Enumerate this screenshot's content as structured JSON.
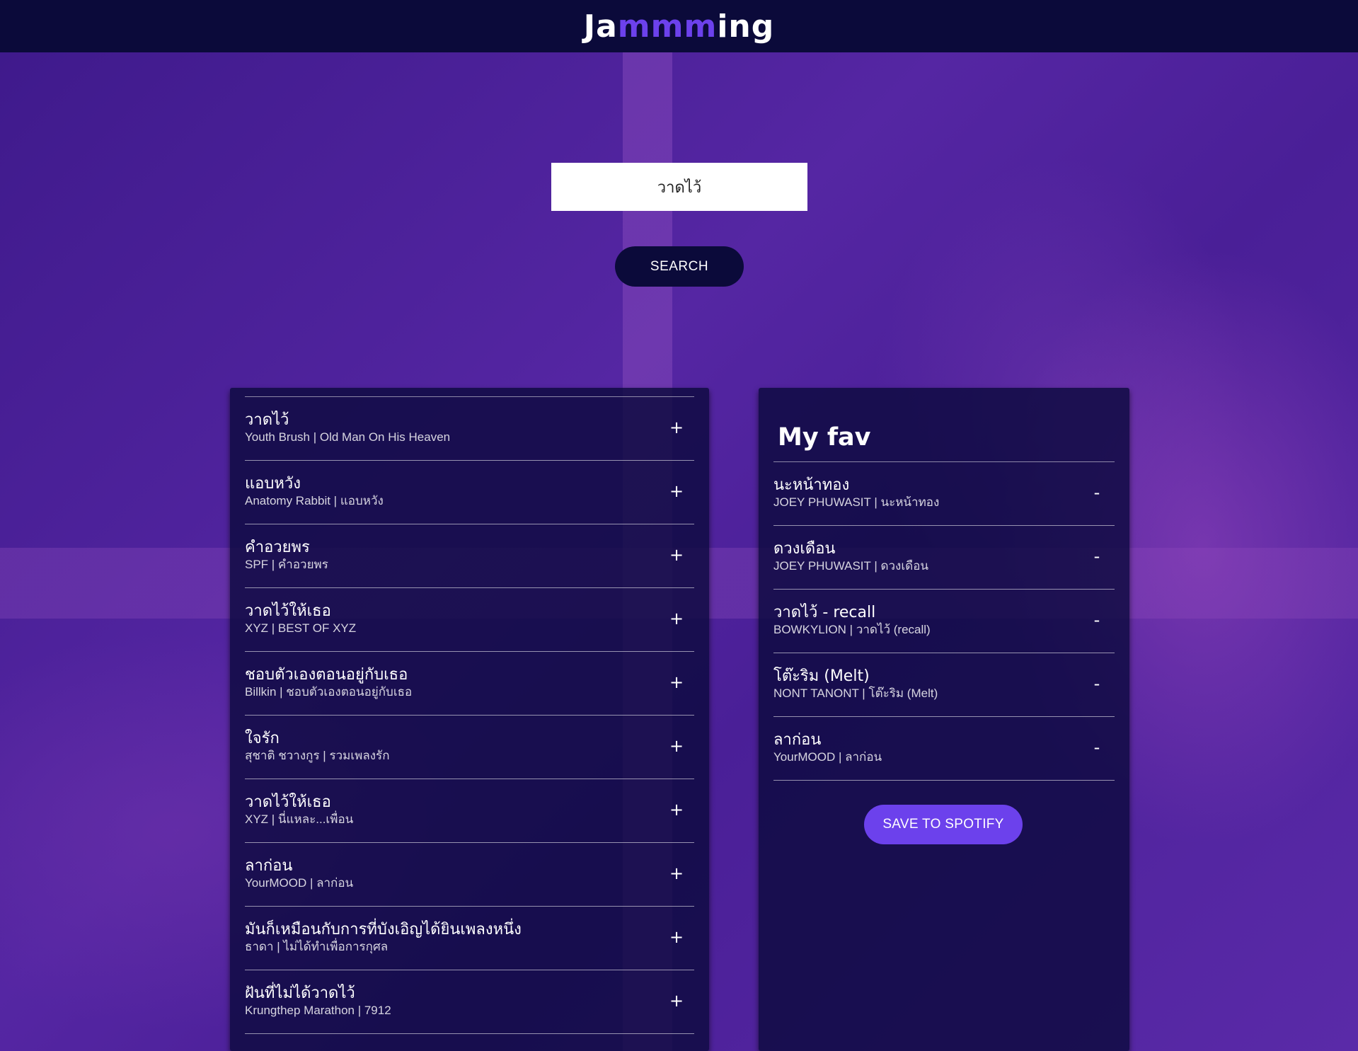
{
  "app": {
    "logo_prefix": "Ja",
    "logo_accent": "mmm",
    "logo_suffix": "ing",
    "accent_color": "#6c41ec",
    "nav_bg_color": "#0b0a3a"
  },
  "search": {
    "value": "วาดไว้",
    "button_label": "SEARCH"
  },
  "results": {
    "tracks": [
      {
        "title": "วาดไว้",
        "meta": "Youth Brush | Old Man On His Heaven",
        "action": "+"
      },
      {
        "title": "แอบหวัง",
        "meta": "Anatomy Rabbit | แอบหวัง",
        "action": "+"
      },
      {
        "title": "คำอวยพร",
        "meta": "SPF | คำอวยพร",
        "action": "+"
      },
      {
        "title": "วาดไว้ให้เธอ",
        "meta": "XYZ | BEST OF XYZ",
        "action": "+"
      },
      {
        "title": "ชอบตัวเองตอนอยู่กับเธอ",
        "meta": "Billkin | ชอบตัวเองตอนอยู่กับเธอ",
        "action": "+"
      },
      {
        "title": "ใจรัก",
        "meta": "สุชาติ ชวางกูร | รวมเพลงรัก",
        "action": "+"
      },
      {
        "title": "วาดไว้ให้เธอ",
        "meta": "XYZ | นี่แหละ...เพื่อน",
        "action": "+"
      },
      {
        "title": "ลาก่อน",
        "meta": "YourMOOD | ลาก่อน",
        "action": "+"
      },
      {
        "title": "มันก็เหมือนกับการที่บังเอิญได้ยินเพลงหนึ่ง",
        "meta": "ธาดา | ไม่ได้ทำเพื่อการกุศล",
        "action": "+"
      },
      {
        "title": "ฝันที่ไม่ได้วาดไว้",
        "meta": "Krungthep Marathon | 7912",
        "action": "+"
      }
    ]
  },
  "playlist": {
    "name": "My fav",
    "tracks": [
      {
        "title": "นะหน้าทอง",
        "meta": "JOEY PHUWASIT | นะหน้าทอง",
        "action": "-"
      },
      {
        "title": "ดวงเดือน",
        "meta": "JOEY PHUWASIT | ดวงเดือน",
        "action": "-"
      },
      {
        "title": "วาดไว้ - recall",
        "meta": "BOWKYLION | วาดไว้ (recall)",
        "action": "-"
      },
      {
        "title": "โต๊ะริม (Melt)",
        "meta": "NONT TANONT | โต๊ะริม (Melt)",
        "action": "-"
      },
      {
        "title": "ลาก่อน",
        "meta": "YourMOOD | ลาก่อน",
        "action": "-"
      }
    ],
    "save_label": "SAVE TO SPOTIFY"
  }
}
